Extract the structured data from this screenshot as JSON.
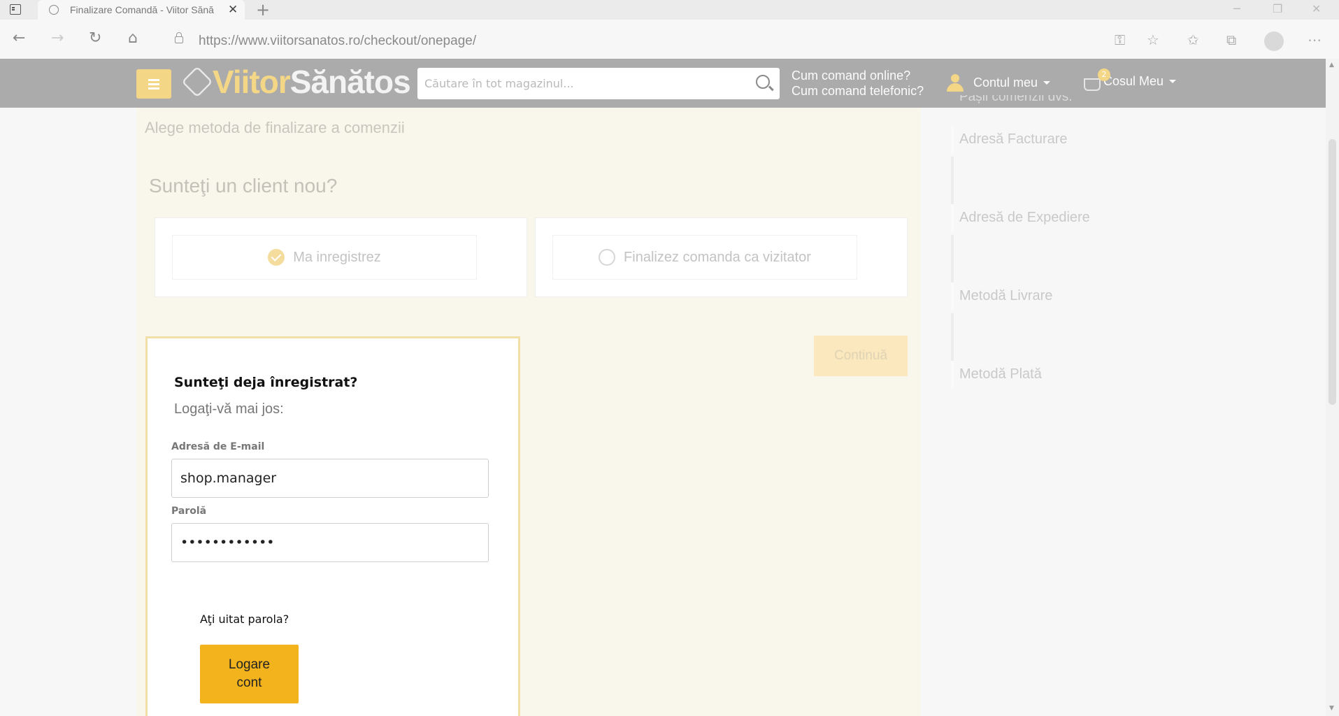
{
  "browser": {
    "tab_title": "Finalizare Comandă - Viitor Sănătos",
    "tab_close": "✕",
    "new_tab": "+",
    "url": "https://www.viitorsanatos.ro/checkout/onepage/",
    "window_controls": [
      "─",
      "❐",
      "✕"
    ]
  },
  "header": {
    "logo_part1": "Viitor",
    "logo_part2": "Sănătos",
    "search_placeholder": "Căutare în tot magazinul...",
    "help_online": "Cum comand online?",
    "help_phone": "Cum comand telefonic?",
    "account_label": "Contul meu",
    "cart_label": "Cosul Meu",
    "cart_count": "2"
  },
  "checkout": {
    "subtitle": "Alege metoda de finalizare a comenzii",
    "new_client_title": "Sunteţi un client nou?",
    "option_register": "Ma inregistrez",
    "option_guest": "Finalizez comanda ca vizitator",
    "continue_label": "Continuă"
  },
  "login": {
    "title": "Sunteţi deja înregistrat?",
    "subtitle": "Logaţi-vă mai jos:",
    "email_label": "Adresă de E-mail",
    "email_value": "shop.manager",
    "password_label": "Parolă",
    "password_value": "••••••••••••",
    "forgot_label": "Aţi uitat parola?",
    "login_button_line1": "Logare",
    "login_button_line2": "cont"
  },
  "steps": {
    "header_partial": "Pașii comenzii dvs.",
    "items": [
      {
        "label": "Adresă Facturare"
      },
      {
        "label": "Adresă de Expediere"
      },
      {
        "label": "Metodă Livrare"
      },
      {
        "label": "Metodă Plată"
      }
    ]
  },
  "colors": {
    "accent_yellow": "#f3b31c",
    "header_gray": "#ababab",
    "content_bg": "#f9f6ec"
  }
}
